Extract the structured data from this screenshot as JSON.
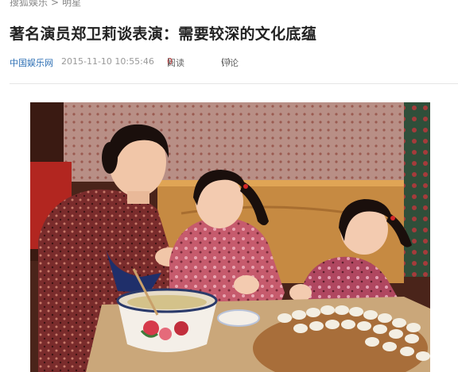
{
  "breadcrumb": {
    "part1": "搜狐娱乐",
    "separator": ">",
    "part2": "明星"
  },
  "article": {
    "title": "著名演员郑卫莉谈表演：需要较深的文化底蕴",
    "source": "中国娱乐网",
    "datetime": "2015-11-10 10:55:46",
    "read_label": "阅读",
    "read_open": "(",
    "read_count": "0",
    "read_close": ")",
    "comment_label": "评论",
    "comment_value": "(   )"
  },
  "colors": {
    "source_link": "#2d6fb4",
    "read_count": "#c33c3c"
  }
}
